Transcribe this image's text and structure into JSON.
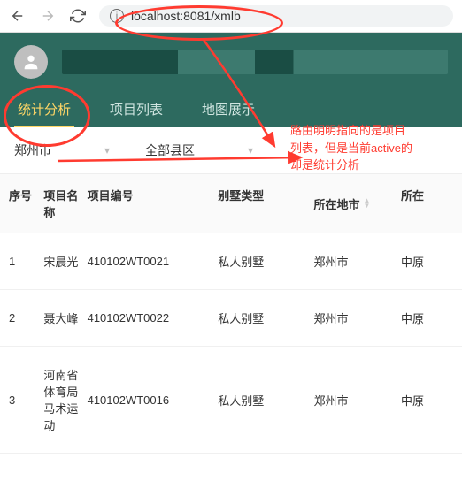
{
  "browser": {
    "url": "localhost:8081/xmlb"
  },
  "tabs": [
    {
      "label": "统计分析",
      "active": true
    },
    {
      "label": "项目列表",
      "active": false
    },
    {
      "label": "地图展示",
      "active": false
    }
  ],
  "filters": {
    "city": "郑州市",
    "district": "全部县区"
  },
  "annotation": {
    "line1": "路由明明指向的是项目",
    "line2": "列表，但是当前active的",
    "line3": "却是统计分析"
  },
  "table": {
    "headers": {
      "index": "序号",
      "name": "项目名称",
      "code": "项目编号",
      "type": "别墅类型",
      "city": "所在地市",
      "last": "所在"
    },
    "rows": [
      {
        "idx": "1",
        "name": "宋晨光",
        "code": "410102WT0021",
        "type": "私人别墅",
        "city": "郑州市",
        "last": "中原"
      },
      {
        "idx": "2",
        "name": "聂大峰",
        "code": "410102WT0022",
        "type": "私人别墅",
        "city": "郑州市",
        "last": "中原"
      },
      {
        "idx": "3",
        "name": "河南省体育局马术运动",
        "code": "410102WT0016",
        "type": "私人别墅",
        "city": "郑州市",
        "last": "中原"
      }
    ]
  }
}
